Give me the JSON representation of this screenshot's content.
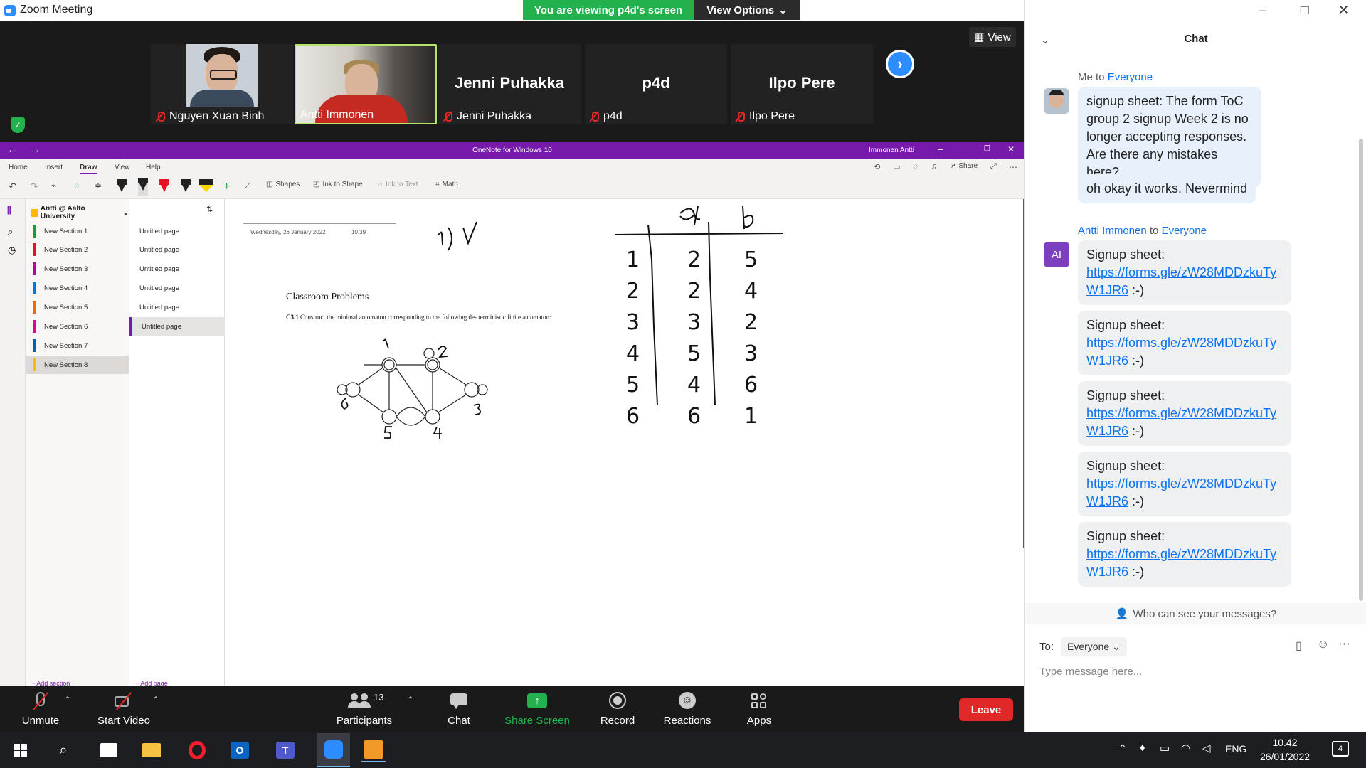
{
  "window": {
    "title": "Zoom Meeting"
  },
  "share_banner": {
    "text": "You are viewing p4d's screen",
    "view_options": "View Options"
  },
  "participants": [
    {
      "name": "Nguyen Xuan Binh",
      "has_video": true
    },
    {
      "name": "Antti Immonen",
      "has_video": true,
      "active_speaker": true
    },
    {
      "name": "Jenni Puhakka",
      "display": "Jenni Puhakka",
      "has_video": false
    },
    {
      "name": "p4d",
      "display": "p4d",
      "has_video": false
    },
    {
      "name": "Ilpo Pere",
      "display": "Ilpo Pere",
      "has_video": false
    }
  ],
  "view_button": "View",
  "onenote": {
    "title": "OneNote for Windows 10",
    "user": "Immonen Antti",
    "tabs": [
      "Home",
      "Insert",
      "Draw",
      "View",
      "Help"
    ],
    "selected_tab": "Draw",
    "tools": {
      "shapes": "Shapes",
      "ink_to_shape": "Ink to Shape",
      "ink_to_text": "Ink to Text",
      "math": "Math",
      "share": "Share"
    },
    "notebook": "Antti @ Aalto University",
    "sections": [
      {
        "label": "New Section 1",
        "color": "#1a9b3c"
      },
      {
        "label": "New Section 2",
        "color": "#e81123"
      },
      {
        "label": "New Section 3",
        "color": "#b4009e"
      },
      {
        "label": "New Section 4",
        "color": "#0078d7"
      },
      {
        "label": "New Section 5",
        "color": "#f7630c"
      },
      {
        "label": "New Section 6",
        "color": "#e3008c"
      },
      {
        "label": "New Section 7",
        "color": "#0063b1"
      },
      {
        "label": "New Section 8",
        "color": "#ffb900"
      }
    ],
    "selected_section": 7,
    "pages": [
      "Untitled page",
      "Untitled page",
      "Untitled page",
      "Untitled page",
      "Untitled page",
      "Untitled page"
    ],
    "selected_page": 5,
    "add_section": "+ Add section",
    "add_page": "+ Add page",
    "page_date": "Wednesday, 26 January 2022",
    "page_time": "10.39",
    "doc_title": "Classroom Problems",
    "problem_number": "C3.1",
    "problem_text": "Construct the minimal automaton corresponding to the following de- terministic finite automaton:",
    "table": {
      "headers": [
        "a",
        "b"
      ],
      "rows": [
        [
          "1",
          "2",
          "5"
        ],
        [
          "2",
          "2",
          "4"
        ],
        [
          "3",
          "3",
          "2"
        ],
        [
          "4",
          "5",
          "3"
        ],
        [
          "5",
          "4",
          "6"
        ],
        [
          "6",
          "6",
          "1"
        ]
      ]
    },
    "note_labels": {
      "one": "1)",
      "check": "V"
    }
  },
  "toolbar": {
    "unmute": "Unmute",
    "start_video": "Start Video",
    "participants": "Participants",
    "participant_count": "13",
    "chat": "Chat",
    "share_screen": "Share Screen",
    "record": "Record",
    "reactions": "Reactions",
    "apps": "Apps",
    "leave": "Leave"
  },
  "chat": {
    "title": "Chat",
    "messages": [
      {
        "from": "Me",
        "to": "Everyone",
        "texts": [
          "signup sheet: The form ToC group 2 signup Week 2 is no longer accepting responses. Are there any mistakes here?",
          "oh okay it works. Nevermind"
        ]
      },
      {
        "from": "Antti Immonen",
        "to": "Everyone",
        "initials": "AI",
        "texts": [
          "Signup sheet:",
          "Signup sheet:",
          "Signup sheet:",
          "Signup sheet:",
          "Signup sheet:"
        ],
        "link": "https://forms.gle/zW28MDDzkuTyW1JR6",
        "suffix": ":-)"
      }
    ],
    "to_label": "Me to",
    "to_word": "to",
    "who_can_see": "Who can see your messages?",
    "to_prefix": "To:",
    "recipient": "Everyone",
    "placeholder": "Type message here..."
  },
  "taskbar": {
    "time": "10.42",
    "date": "26/01/2022",
    "lang": "ENG",
    "notifications": "4"
  }
}
